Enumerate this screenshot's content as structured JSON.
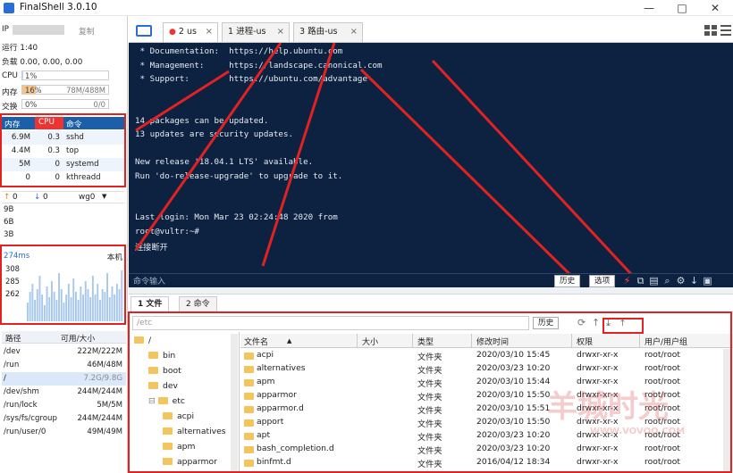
{
  "app": {
    "title": "FinalShell 3.0.10"
  },
  "window": {
    "minimize": "—",
    "maximize": "□",
    "close": "✕"
  },
  "sidebar": {
    "ip_label": "IP",
    "copy_label": "复制",
    "uptime": "运行 1:40",
    "load": "负载 0.00, 0.00, 0.00",
    "cpu": {
      "label": "CPU",
      "value": "1%",
      "fraction": 0.01
    },
    "mem": {
      "label": "内存",
      "value": "16%",
      "detail": "78M/488M",
      "fraction": 0.16
    },
    "swap": {
      "label": "交换",
      "value": "0%",
      "detail": "0/0",
      "fraction": 0
    },
    "proc_headers": [
      "内存",
      "CPU",
      "命令"
    ],
    "processes": [
      {
        "mem": "6.9M",
        "cpu": "0.3",
        "cmd": "sshd"
      },
      {
        "mem": "4.4M",
        "cpu": "0.3",
        "cmd": "top"
      },
      {
        "mem": "5M",
        "cpu": "0",
        "cmd": "systemd"
      },
      {
        "mem": "0",
        "cpu": "0",
        "cmd": "kthreadd"
      }
    ],
    "net": {
      "up": "0",
      "down": "0",
      "iface": "wg0",
      "levels": [
        "9B",
        "6B",
        "3B"
      ]
    },
    "ping": {
      "latency": "274ms",
      "host": "本机",
      "ticks": [
        "308",
        "285",
        "262"
      ],
      "bars": [
        0.35,
        0.55,
        0.7,
        0.4,
        0.6,
        0.85,
        0.5,
        0.3,
        0.65,
        0.45,
        0.75,
        0.55,
        0.4,
        0.9,
        0.6,
        0.35,
        0.5,
        0.7,
        0.45,
        0.8,
        0.55,
        0.4,
        0.65,
        0.5,
        0.75,
        0.6,
        0.45,
        0.85,
        0.5,
        0.7,
        0.4,
        0.6,
        0.55,
        0.9,
        0.45,
        0.65,
        0.5,
        0.7,
        0.6,
        0.95
      ]
    },
    "drive_headers": [
      "路径",
      "可用/大小"
    ],
    "drives": [
      {
        "path": "/dev",
        "size": "222M/222M"
      },
      {
        "path": "/run",
        "size": "46M/48M"
      },
      {
        "path": "/",
        "size": "7.2G/9.8G"
      },
      {
        "path": "/dev/shm",
        "size": "244M/244M"
      },
      {
        "path": "/run/lock",
        "size": "5M/5M"
      },
      {
        "path": "/sys/fs/cgroup",
        "size": "244M/244M"
      },
      {
        "path": "/run/user/0",
        "size": "49M/49M"
      }
    ]
  },
  "tabs": [
    {
      "label": "2 us",
      "close": "×"
    },
    {
      "label": "1 进程-us",
      "close": "×"
    },
    {
      "label": "3 路由-us",
      "close": "×"
    }
  ],
  "terminal": {
    "lines": [
      " * Documentation:  https://help.ubuntu.com",
      " * Management:     https://landscape.canonical.com",
      " * Support:        https://ubuntu.com/advantage",
      "",
      "",
      "14 packages can be updated.",
      "13 updates are security updates.",
      "",
      "New release '18.04.1 LTS' available.",
      "Run 'do-release-upgrade' to upgrade to it.",
      "",
      "",
      "Last login: Mon Mar 23 02:24:48 2020 from",
      "root@vultr:~#",
      "连接断开"
    ],
    "cmd_placeholder": "命令输入",
    "history": "历史",
    "options": "选项"
  },
  "files": {
    "tabs": [
      "1 文件",
      "2 命令"
    ],
    "path": "/etc",
    "history": "历史",
    "tree": [
      {
        "name": "/",
        "indent": 0
      },
      {
        "name": "bin",
        "indent": 1
      },
      {
        "name": "boot",
        "indent": 1
      },
      {
        "name": "dev",
        "indent": 1
      },
      {
        "name": "etc",
        "indent": 1
      },
      {
        "name": "acpi",
        "indent": 2
      },
      {
        "name": "alternatives",
        "indent": 2
      },
      {
        "name": "apm",
        "indent": 2
      },
      {
        "name": "apparmor",
        "indent": 2
      }
    ],
    "headers": [
      "文件名",
      "大小",
      "类型",
      "修改时间",
      "权限",
      "用户/用户组"
    ],
    "rows": [
      {
        "name": "acpi",
        "type": "文件夹",
        "time": "2020/03/10 15:45",
        "perm": "drwxr-xr-x",
        "owner": "root/root"
      },
      {
        "name": "alternatives",
        "type": "文件夹",
        "time": "2020/03/23 10:20",
        "perm": "drwxr-xr-x",
        "owner": "root/root"
      },
      {
        "name": "apm",
        "type": "文件夹",
        "time": "2020/03/10 15:44",
        "perm": "drwxr-xr-x",
        "owner": "root/root"
      },
      {
        "name": "apparmor",
        "type": "文件夹",
        "time": "2020/03/10 15:50",
        "perm": "drwxr-xr-x",
        "owner": "root/root"
      },
      {
        "name": "apparmor.d",
        "type": "文件夹",
        "time": "2020/03/10 15:51",
        "perm": "drwxr-xr-x",
        "owner": "root/root"
      },
      {
        "name": "apport",
        "type": "文件夹",
        "time": "2020/03/10 15:50",
        "perm": "drwxr-xr-x",
        "owner": "root/root"
      },
      {
        "name": "apt",
        "type": "文件夹",
        "time": "2020/03/23 10:20",
        "perm": "drwxr-xr-x",
        "owner": "root/root"
      },
      {
        "name": "bash_completion.d",
        "type": "文件夹",
        "time": "2020/03/23 10:20",
        "perm": "drwxr-xr-x",
        "owner": "root/root"
      },
      {
        "name": "binfmt.d",
        "type": "文件夹",
        "time": "2016/04/12 18:34",
        "perm": "drwxr-xr-x",
        "owner": "root/root"
      }
    ]
  },
  "watermark": {
    "brand": "羊城时光",
    "url": "WWW.VOVQQ.COM"
  },
  "colors": {
    "terminal_bg": "#0d2240",
    "annotation_red": "#e02222",
    "proc_header": "#1a5fa8",
    "cpu_header": "#ee3333"
  }
}
